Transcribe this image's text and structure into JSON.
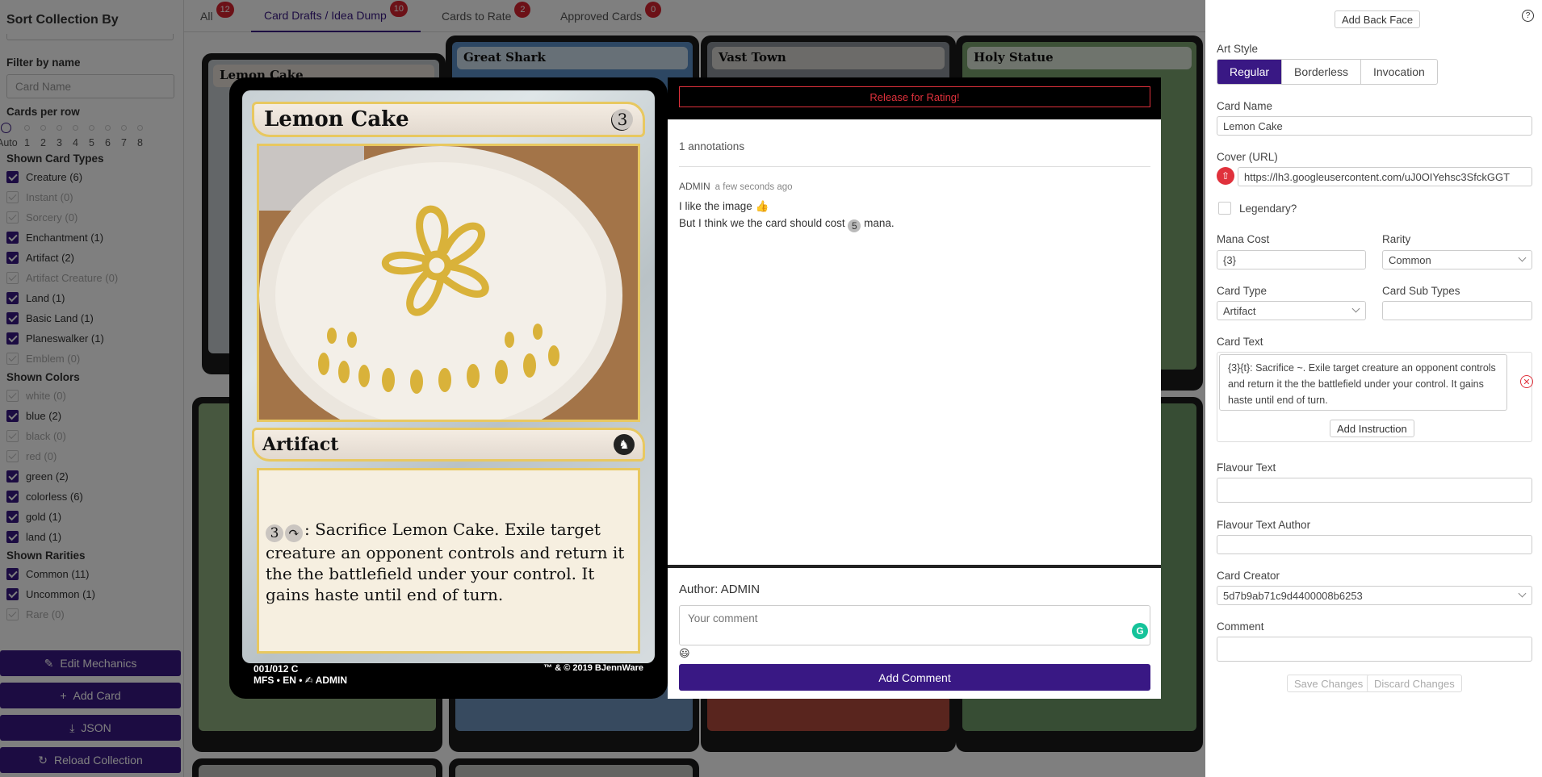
{
  "sidebar": {
    "sort_title": "Sort Collection By",
    "filter_label": "Filter by name",
    "filter_placeholder": "Card Name",
    "rows_label": "Cards per row",
    "rows_options": [
      "Auto",
      "1",
      "2",
      "3",
      "4",
      "5",
      "6",
      "7",
      "8"
    ],
    "types_title": "Shown Card Types",
    "types": [
      {
        "label": "Creature (6)",
        "checked": true
      },
      {
        "label": "Instant (0)",
        "checked": false
      },
      {
        "label": "Sorcery (0)",
        "checked": false
      },
      {
        "label": "Enchantment (1)",
        "checked": true
      },
      {
        "label": "Artifact (2)",
        "checked": true
      },
      {
        "label": "Artifact Creature (0)",
        "checked": false
      },
      {
        "label": "Land (1)",
        "checked": true
      },
      {
        "label": "Basic Land (1)",
        "checked": true
      },
      {
        "label": "Planeswalker (1)",
        "checked": true
      },
      {
        "label": "Emblem (0)",
        "checked": false
      }
    ],
    "colors_title": "Shown Colors",
    "colors": [
      {
        "label": "white (0)",
        "checked": false
      },
      {
        "label": "blue (2)",
        "checked": true
      },
      {
        "label": "black (0)",
        "checked": false
      },
      {
        "label": "red (0)",
        "checked": false
      },
      {
        "label": "green (2)",
        "checked": true
      },
      {
        "label": "colorless (6)",
        "checked": true
      },
      {
        "label": "gold (1)",
        "checked": true
      },
      {
        "label": "land (1)",
        "checked": true
      }
    ],
    "rarities_title": "Shown Rarities",
    "rarities": [
      {
        "label": "Common (11)",
        "checked": true
      },
      {
        "label": "Uncommon (1)",
        "checked": true
      },
      {
        "label": "Rare (0)",
        "checked": false
      }
    ],
    "buttons": {
      "edit_mechanics": "Edit Mechanics",
      "add_card": "Add Card",
      "json": "JSON",
      "reload": "Reload Collection"
    }
  },
  "tabs": [
    {
      "label": "All",
      "count": "12"
    },
    {
      "label": "Card Drafts / Idea Dump",
      "count": "10"
    },
    {
      "label": "Cards to Rate",
      "count": "2"
    },
    {
      "label": "Approved Cards",
      "count": "0"
    }
  ],
  "grid_cards": [
    {
      "name": "Lemon Cake"
    },
    {
      "name": "Great Shark"
    },
    {
      "name": "Vast Town"
    },
    {
      "name": "Holy Statue"
    }
  ],
  "modal": {
    "card": {
      "name": "Lemon Cake",
      "cost": "3",
      "type": "Artifact",
      "text_cost": "3",
      "text_tap": "↷",
      "text": ": Sacrifice Lemon Cake. Exile target creature an opponent controls and return it the the battlefield under your control. It gains haste until end of turn.",
      "footer_number": "001/012 C",
      "footer_set": "MFS • EN • ✍ ADMIN",
      "copyright": "™ & © 2019 BJennWare"
    },
    "release_label": "Release for Rating!",
    "annotations_count": "1 annotations",
    "annotation": {
      "author": "ADMIN",
      "time": "a few seconds ago",
      "line1": "I like the image 👍",
      "line2_pre": "But I think we the card should cost",
      "line2_mana": "5",
      "line2_post": "mana."
    },
    "author_label": "Author: ADMIN",
    "comment_placeholder": "Your comment",
    "add_comment": "Add Comment"
  },
  "edit": {
    "add_back_face": "Add Back Face",
    "help": "?",
    "art_style_label": "Art Style",
    "art_styles": [
      "Regular",
      "Borderless",
      "Invocation"
    ],
    "card_name_label": "Card Name",
    "card_name_value": "Lemon Cake",
    "cover_label": "Cover (URL)",
    "cover_value": "https://lh3.googleusercontent.com/uJ0OIYehsc3SfckGGT",
    "legendary_label": "Legendary?",
    "mana_cost_label": "Mana Cost",
    "mana_cost_value": "{3}",
    "rarity_label": "Rarity",
    "rarity_value": "Common",
    "card_type_label": "Card Type",
    "card_type_value": "Artifact",
    "sub_types_label": "Card Sub Types",
    "card_text_label": "Card Text",
    "card_text_value": "{3}{t}: Sacrifice ~. Exile target creature an opponent controls and return it the the battlefield under your control. It gains haste until end of turn.",
    "add_instruction": "Add Instruction",
    "flavour_label": "Flavour Text",
    "flavour_author_label": "Flavour Text Author",
    "creator_label": "Card Creator",
    "creator_value": "5d7b9ab71c9d4400008b6253",
    "comment_label": "Comment",
    "save": "Save Changes",
    "discard": "Discard Changes"
  },
  "colors": {
    "accent": "#391884",
    "badge": "#d9232f",
    "danger": "#e0313c"
  }
}
